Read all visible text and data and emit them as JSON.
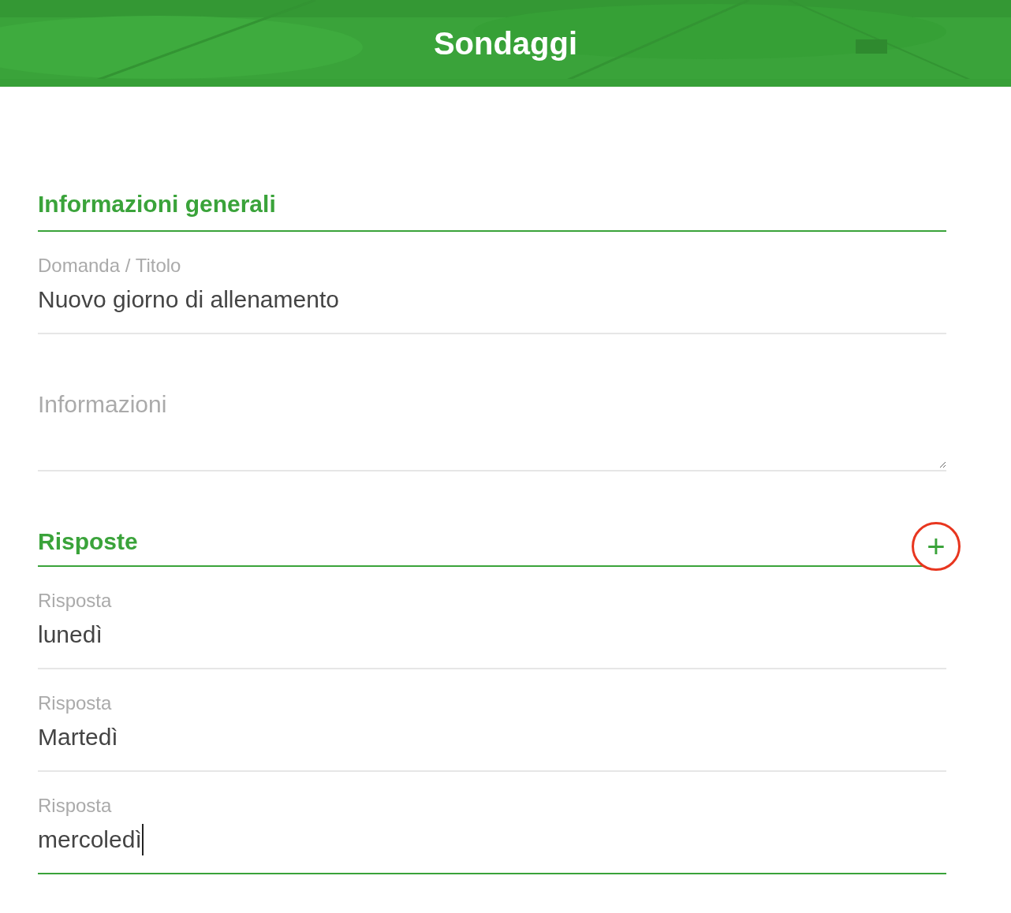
{
  "header": {
    "title": "Sondaggi"
  },
  "general": {
    "heading": "Informazioni generali",
    "question": {
      "label": "Domanda / Titolo",
      "value": "Nuovo giorno di allenamento",
      "focused": false
    },
    "info": {
      "placeholder": "Informazioni"
    }
  },
  "answers": {
    "heading": "Risposte",
    "add_button": "+",
    "items": [
      {
        "label": "Risposta",
        "value": "lunedì",
        "focused": false
      },
      {
        "label": "Risposta",
        "value": "Martedì",
        "focused": false
      },
      {
        "label": "Risposta",
        "value": "mercoledì",
        "focused": true
      }
    ]
  }
}
